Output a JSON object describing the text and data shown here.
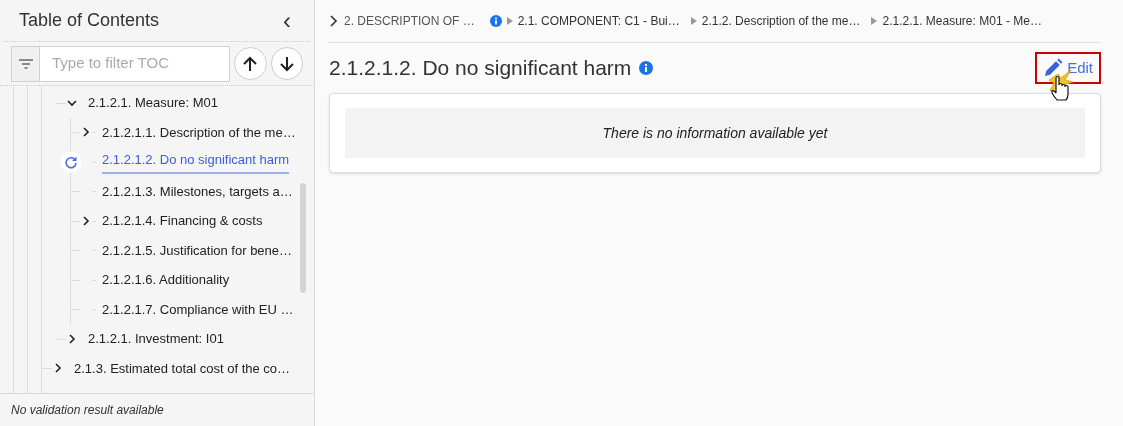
{
  "sidebar": {
    "title": "Table of Contents",
    "collapse_icon": "‹",
    "filter": {
      "placeholder": "Type to filter TOC"
    },
    "toc": [
      {
        "children": [
          {
            "label": "2.1.2.1. Measure: M01",
            "expanded": true,
            "selected": false,
            "children": [
              {
                "label": "2.1.2.1.1. Description of the me…",
                "expanded": false,
                "selected": false,
                "has_children": true
              },
              {
                "label": "2.1.2.1.2. Do no significant harm",
                "expanded": false,
                "selected": true,
                "has_children": false
              },
              {
                "label": "2.1.2.1.3. Milestones, targets a…",
                "expanded": false,
                "selected": false,
                "has_children": false
              },
              {
                "label": "2.1.2.1.4. Financing & costs",
                "expanded": false,
                "selected": false,
                "has_children": true
              },
              {
                "label": "2.1.2.1.5. Justification for bene…",
                "expanded": false,
                "selected": false,
                "has_children": false
              },
              {
                "label": "2.1.2.1.6. Additionality",
                "expanded": false,
                "selected": false,
                "has_children": false
              },
              {
                "label": "2.1.2.1.7. Compliance with EU …",
                "expanded": false,
                "selected": false,
                "has_children": false
              }
            ]
          },
          {
            "label": "2.1.2.1. Investment: I01",
            "expanded": false,
            "selected": false,
            "has_children": true
          }
        ]
      },
      {
        "label": "2.1.3. Estimated total cost of the co…",
        "expanded": false,
        "selected": false,
        "has_children": true
      }
    ],
    "status": "No validation result available"
  },
  "breadcrumb": [
    "2. DESCRIPTION OF …",
    "2.1. COMPONENT: C1 - Bui…",
    "2.1.2. Description of the me…",
    "2.1.2.1. Measure: M01 - Me…"
  ],
  "section": {
    "title": "2.1.2.1.2. Do no significant harm",
    "edit_button": "Edit",
    "empty_message": "There is no information available yet"
  }
}
